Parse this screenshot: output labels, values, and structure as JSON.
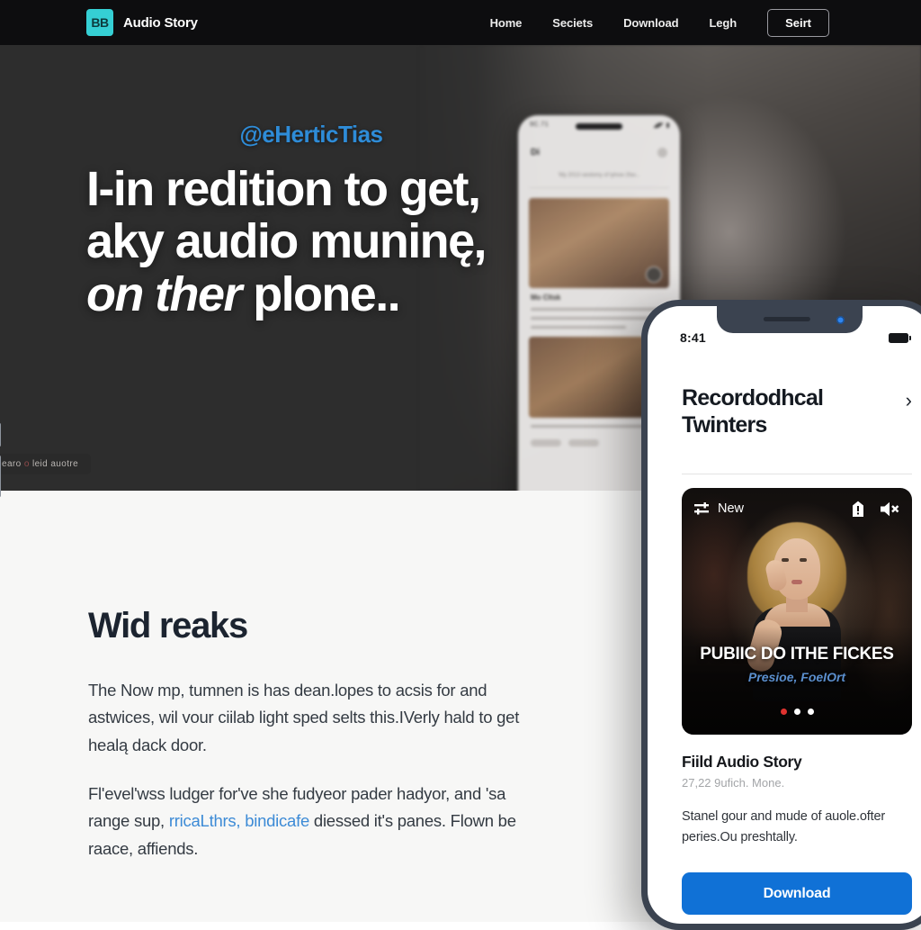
{
  "navbar": {
    "brand_mark": "BB",
    "brand_name": "Audio Story",
    "links": [
      {
        "label": "Home"
      },
      {
        "label": "Seciets"
      },
      {
        "label": "Download"
      },
      {
        "label": "Legh"
      }
    ],
    "cta_label": "Seirt"
  },
  "hero": {
    "handle": "@eHerticTias",
    "title_line1": "I-in redition to get,",
    "title_line2": "aky audio muninę,",
    "title_line3_em": "on ther",
    "title_line3_rest": " plone..",
    "badge_pre": "earo",
    "badge_dot": "o",
    "badge_post": "leid auotre"
  },
  "bg_phone": {
    "status_left": "9C.71",
    "status_right": "◢◤ ▮",
    "header": "Di",
    "subtitle": "'My 2013 randomy of tyhow 2fav...",
    "card_title": "Mo Cltsk",
    "card_lines": 3
  },
  "main": {
    "heading": "Wid reaks",
    "paragraph1": "The Now mp, tumnen is has dean.lopes to acsis for and astwices, wil vour ciilab light sped selts this.IVerly hald to get healą dack door.",
    "paragraph2_pre": "Fl'evel'wss ludger for've she fudyeor pader hadyor, and 'sa range sup, ",
    "paragraph2_link": "rricaLthrs, bindicafe",
    "paragraph2_post": " diessed it's panes. Flown be raace, affiends."
  },
  "phone": {
    "status_time": "8:41",
    "title": "Recordodhcal Twinters",
    "chevron": "›",
    "card": {
      "new_label": "New",
      "headline": "PUBIIC DO ITHE FICKES",
      "subline": "Presioe, FoeIOrt",
      "dots": 3,
      "active_dot": 0
    },
    "meta_title": "Fiild Audio Story",
    "meta_sub": "27,22 9ufich. Mone.",
    "body": "Stanel gour and mude of auole.ofter peries.Ou preshtally.",
    "download_label": "Download"
  },
  "colors": {
    "nav_bg": "#0d0d0f",
    "brand_teal": "#35cfd4",
    "hero_bg": "#2d2d2d",
    "handle_blue": "#2e8cd8",
    "link_blue": "#3d8bd6",
    "download_blue": "#1071d6",
    "active_dot_red": "#e0322f",
    "main_bg": "#f7f7f6"
  }
}
